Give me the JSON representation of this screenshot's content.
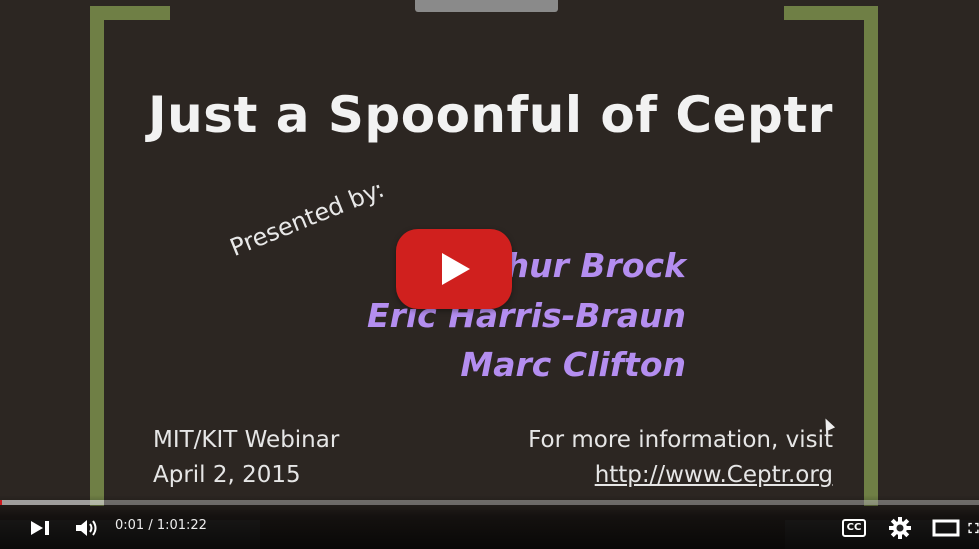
{
  "slide": {
    "title": "Just a Spoonful of Ceptr",
    "presented_by": "Presented by:",
    "presenters": [
      "Arthur Brock",
      "Eric Harris-Braun",
      "Marc Clifton"
    ],
    "event": "MIT/KIT Webinar",
    "date": "April 2, 2015",
    "info_text": "For more information, visit",
    "url": "http://www.Ceptr.org"
  },
  "player": {
    "current_time": "0:01",
    "duration": "1:01:22",
    "time_display": "0:01 / 1:01:22",
    "progress_fraction": 0.0003,
    "cc_label": "CC",
    "play_button_color": "#d0201e",
    "progress_color": "#cc181e"
  },
  "colors": {
    "background": "#2c2622",
    "frame": "#6f7f45",
    "presenter_text": "#b48ef0",
    "title_text": "#f2f2f2"
  },
  "icons": [
    "play-icon",
    "next-icon",
    "volume-icon",
    "cc-icon",
    "settings-icon",
    "theater-icon",
    "fullscreen-icon"
  ]
}
